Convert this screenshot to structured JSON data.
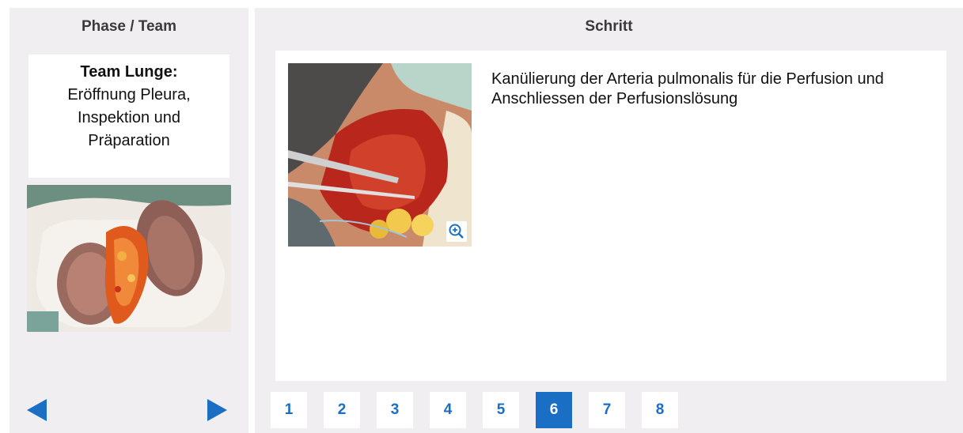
{
  "left_panel": {
    "title": "Phase / Team",
    "team_name": "Team Lunge:",
    "team_description": "Eröffnung Pleura, Inspektion und Präparation",
    "image_icon": "lung-photo"
  },
  "right_panel": {
    "title": "Schritt",
    "step_text": "Kanülierung der Arteria pulmonalis für die Perfusion und Anschliessen der Perfusionslösung",
    "image_icon": "surgery-photo",
    "zoom_icon": "zoom-in-icon"
  },
  "navigation": {
    "prev_icon": "triangle-left-icon",
    "next_icon": "triangle-right-icon"
  },
  "pager": {
    "pages": [
      "1",
      "2",
      "3",
      "4",
      "5",
      "6",
      "7",
      "8"
    ],
    "active": "6"
  },
  "colors": {
    "accent": "#1a6fc4",
    "panel_bg": "#f1eef1",
    "box_bg": "#ffffff"
  }
}
